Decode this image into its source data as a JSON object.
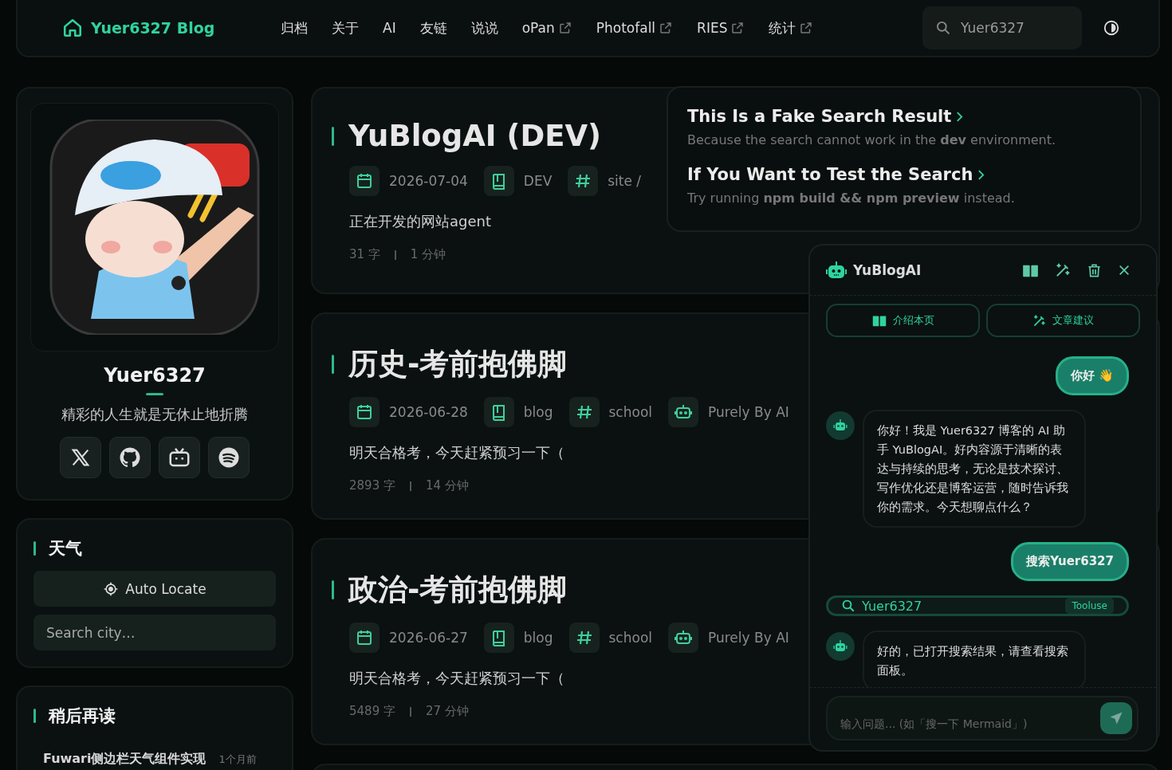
{
  "nav": {
    "brand": "Yuer6327 Blog",
    "links": [
      {
        "label": "归档",
        "external": false
      },
      {
        "label": "关于",
        "external": false
      },
      {
        "label": "AI",
        "external": false
      },
      {
        "label": "友链",
        "external": false
      },
      {
        "label": "说说",
        "external": false
      },
      {
        "label": "oPan",
        "external": true
      },
      {
        "label": "Photofall",
        "external": true
      },
      {
        "label": "RIES",
        "external": true
      },
      {
        "label": "统计",
        "external": true
      }
    ],
    "search": {
      "value": "Yuer6327"
    }
  },
  "profile": {
    "name": "Yuer6327",
    "bio": "精彩的人生就是无休止地折腾",
    "socials": [
      {
        "kind": "x"
      },
      {
        "kind": "github"
      },
      {
        "kind": "bilibili"
      },
      {
        "kind": "spotify"
      }
    ]
  },
  "weather": {
    "title": "天气",
    "locate_button": "Auto Locate",
    "search": {
      "placeholder": "Search city…"
    }
  },
  "read_later": {
    "title": "稍后再读",
    "items": [
      {
        "title": "Fuwari侧边栏天气组件实现",
        "time": "1个月前"
      }
    ]
  },
  "posts": [
    {
      "title": "YuBlogAI (DEV)",
      "date": "2026-07-04",
      "category": "DEV",
      "tags": "site /",
      "description": "正在开发的网站agent",
      "words": "31 字",
      "minutes": "1 分钟"
    },
    {
      "title": "历史-考前抱佛脚",
      "date": "2026-06-28",
      "category": "blog",
      "tags": "school",
      "author": "Purely By AI",
      "description": "明天合格考，今天赶紧预习一下（",
      "words": "2893 字",
      "minutes": "14 分钟"
    },
    {
      "title": "政治-考前抱佛脚",
      "date": "2026-06-27",
      "category": "blog",
      "tags": "school",
      "author": "Purely By AI",
      "description": "明天合格考，今天赶紧预习一下（",
      "words": "5489 字",
      "minutes": "27 分钟"
    }
  ],
  "search_results": [
    {
      "title": "This Is a Fake Search Result",
      "snippet": "Because the search cannot work in the **dev** environment."
    },
    {
      "title": "If You Want to Test the Search",
      "snippet": "Try running **npm build && npm preview** instead."
    }
  ],
  "chat": {
    "title": "YuBlogAI",
    "quick_actions": [
      {
        "kind": "book",
        "label": "介绍本页"
      },
      {
        "kind": "wand",
        "label": "文章建议"
      }
    ],
    "messages": [
      {
        "kind": "user",
        "text": "你好 👋"
      },
      {
        "kind": "bot",
        "text": "你好！我是 Yuer6327 博客的 AI 助手 YuBlogAI。好内容源于清晰的表达与持续的思考，无论是技术探讨、写作优化还是博客运营，随时告诉我你的需求。今天想聊点什么？"
      },
      {
        "kind": "user",
        "text": "搜索Yuer6327"
      },
      {
        "kind": "tool",
        "query": "Yuer6327",
        "badge": "Tooluse"
      },
      {
        "kind": "bot",
        "text": "好的，已打开搜索结果，请查看搜索面板。"
      }
    ],
    "input": {
      "placeholder": "输入问题... (如「搜一下 Mermaid」)"
    }
  }
}
